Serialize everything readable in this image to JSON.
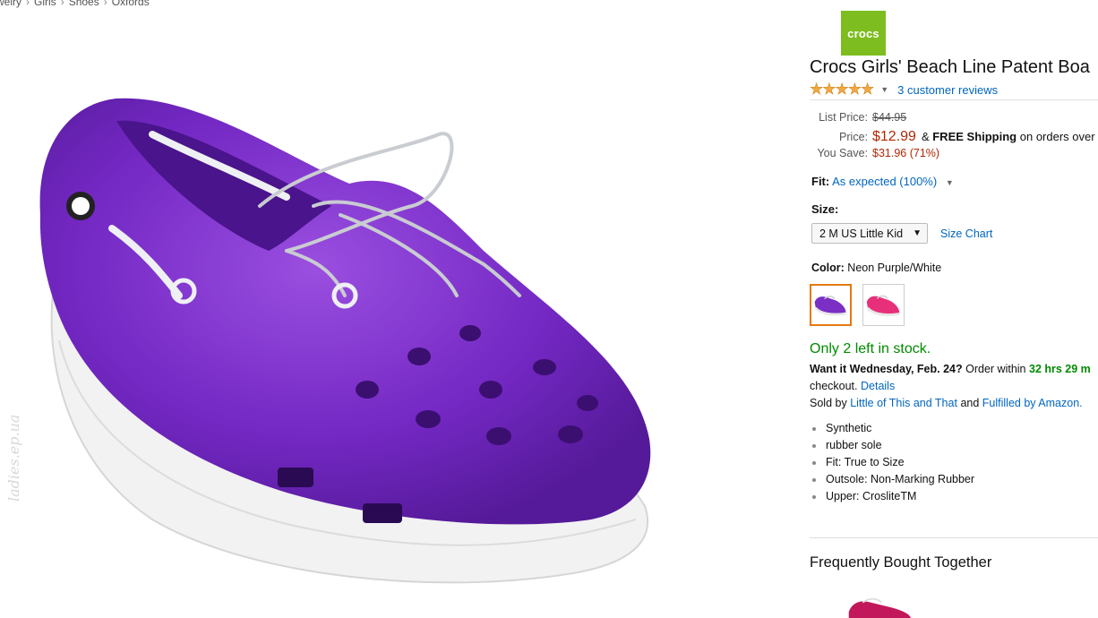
{
  "breadcrumb": [
    "welry",
    "Girls",
    "Shoes",
    "Oxfords"
  ],
  "watermark": "ladies.ep.ua",
  "brand": {
    "logo_text": "crocs",
    "color": "#7dbd1f"
  },
  "product": {
    "title": "Crocs Girls' Beach Line Patent Boa",
    "rating_stars": 5,
    "stars_glyph": "★★★★★",
    "reviews_text": "3 customer reviews",
    "image_color": "Neon Purple/White"
  },
  "price": {
    "list_label": "List Price:",
    "list_value": "$44.95",
    "price_label": "Price:",
    "price_value": "$12.99",
    "shipping_amp": "&",
    "shipping_bold": "FREE Shipping",
    "shipping_rest": "on orders over",
    "save_label": "You Save:",
    "save_value": "$31.96 (71%)"
  },
  "fit": {
    "label": "Fit:",
    "value": "As expected (100%)"
  },
  "size": {
    "label": "Size:",
    "selected": "2 M US Little Kid",
    "chart_link": "Size Chart"
  },
  "color": {
    "label": "Color:",
    "value": "Neon Purple/White",
    "swatches": [
      {
        "name": "Neon Purple/White",
        "color": "#7b2fc4"
      },
      {
        "name": "Pink",
        "color": "#e8307a"
      }
    ]
  },
  "stock": "Only 2 left in stock.",
  "delivery": {
    "want_bold": "Want it Wednesday, Feb. 24?",
    "order_within": "Order within",
    "time_bold": "32 hrs 29 m",
    "checkout": "checkout.",
    "details": "Details",
    "sold_by": "Sold by",
    "seller": "Little of This and That",
    "and": "and",
    "fulfilled": "Fulfilled by Amazon."
  },
  "features": [
    "Synthetic",
    "rubber sole",
    "Fit: True to Size",
    "Outsole: Non-Marking Rubber",
    "Upper: CrosliteTM"
  ],
  "frequently_bought": "Frequently Bought Together",
  "colors": {
    "link": "#0066c0",
    "price": "#b12704",
    "instock": "#008a00",
    "selected_swatch": "#e47911"
  }
}
